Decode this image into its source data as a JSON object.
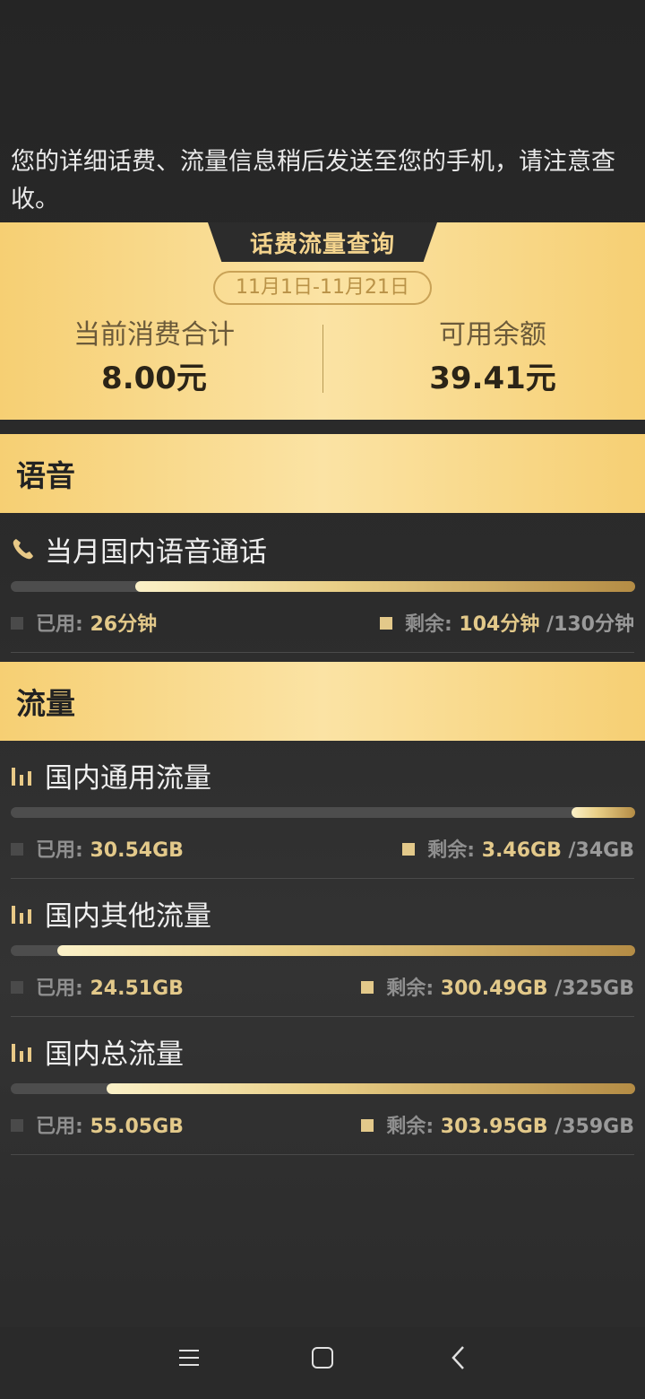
{
  "notice": "您的详细话费、流量信息稍后发送至您的手机，请注意查收。",
  "summary": {
    "tab_label": "话费流量查询",
    "date_range": "11月1日-11月21日",
    "current_label": "当前消费合计",
    "current_value": "8.00元",
    "balance_label": "可用余额",
    "balance_value": "39.41元"
  },
  "voice": {
    "section_label": "语音",
    "items": [
      {
        "title": "当月国内语音通话",
        "used_label": "已用:",
        "used_value": "26分钟",
        "left_label": "剩余:",
        "left_value": "104分钟",
        "total": "/130分钟",
        "remaining_fraction": 0.8
      }
    ]
  },
  "data": {
    "section_label": "流量",
    "items": [
      {
        "title": "国内通用流量",
        "used_label": "已用:",
        "used_value": "30.54GB",
        "left_label": "剩余:",
        "left_value": "3.46GB",
        "total": "/34GB",
        "remaining_fraction": 0.102
      },
      {
        "title": "国内其他流量",
        "used_label": "已用:",
        "used_value": "24.51GB",
        "left_label": "剩余:",
        "left_value": "300.49GB",
        "total": "/325GB",
        "remaining_fraction": 0.925
      },
      {
        "title": "国内总流量",
        "used_label": "已用:",
        "used_value": "55.05GB",
        "left_label": "剩余:",
        "left_value": "303.95GB",
        "total": "/359GB",
        "remaining_fraction": 0.847
      }
    ]
  },
  "icons": {
    "phone": "phone-icon",
    "bars": "signal-bars-icon",
    "menu": "menu-icon",
    "home": "home-icon",
    "back": "back-icon"
  },
  "colors": {
    "gold": "#f6cf73",
    "gold_text": "#e3c98a",
    "background": "#2a2a2a"
  }
}
